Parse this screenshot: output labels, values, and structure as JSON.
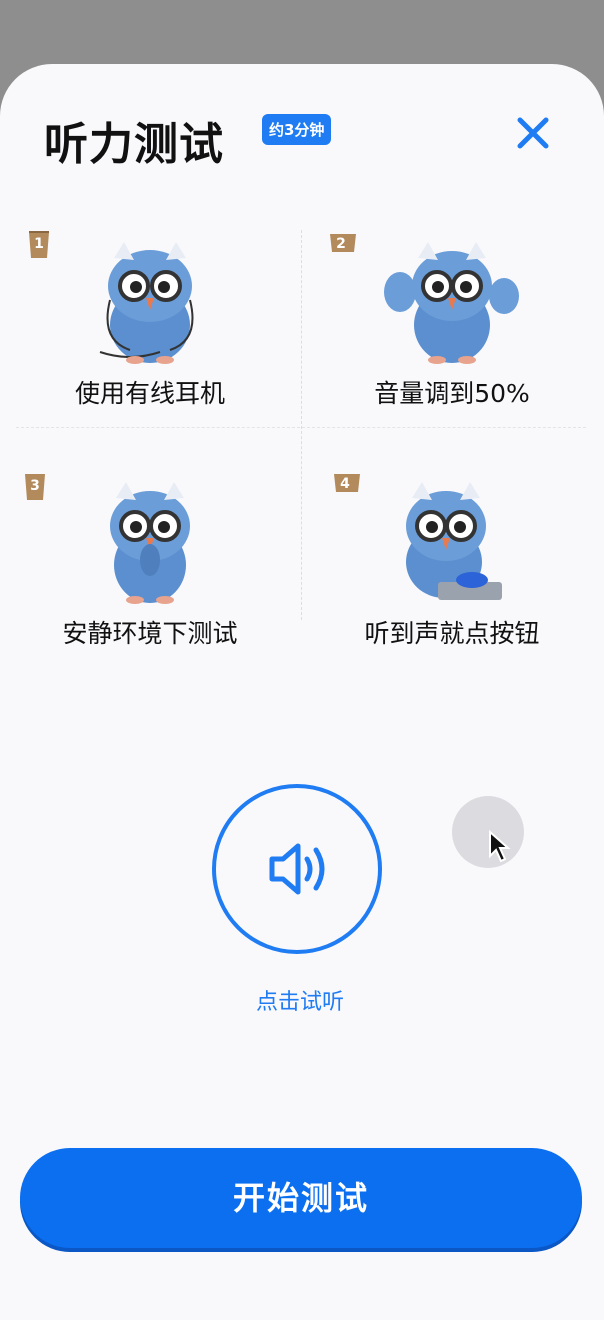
{
  "header": {
    "title": "听力测试",
    "duration_badge": "约3分钟",
    "close_icon": "close-icon"
  },
  "steps": [
    {
      "number": "1",
      "label": "使用有线耳机",
      "icon": "owl-headphones"
    },
    {
      "number": "2",
      "label": "音量调到50%",
      "icon": "owl-waving"
    },
    {
      "number": "3",
      "label": "安静环境下测试",
      "icon": "owl-shush"
    },
    {
      "number": "4",
      "label": "听到声就点按钮",
      "icon": "owl-button"
    }
  ],
  "preview": {
    "icon": "speaker-icon",
    "label": "点击试听"
  },
  "start_button": {
    "label": "开始测试"
  },
  "colors": {
    "accent": "#1f7cf2",
    "button": "#0b6ff0",
    "background": "#f9f9fc"
  }
}
